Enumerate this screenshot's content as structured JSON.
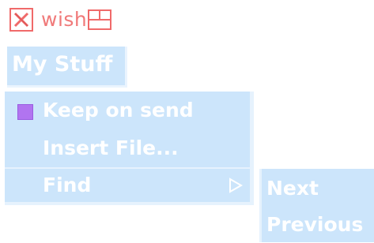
{
  "toolbar": {
    "wish_label": "wish",
    "close_icon": "x-icon",
    "window_icon": "window-icon"
  },
  "menubutton": {
    "label": "My Stuff"
  },
  "menu": {
    "items": [
      {
        "label": "Keep on send",
        "type": "checkbutton",
        "checked": true
      },
      {
        "label": "Insert File...",
        "type": "command"
      },
      {
        "label": "Find",
        "type": "cascade"
      }
    ]
  },
  "submenu": {
    "items": [
      {
        "label": "Next"
      },
      {
        "label": "Previous"
      }
    ]
  },
  "colors": {
    "menu_bg": "#cce5fb",
    "menu_text": "#ffffff",
    "accent_red": "#f06a6a",
    "check_purple": "#b174f0"
  }
}
